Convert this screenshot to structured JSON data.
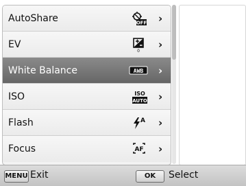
{
  "menu": {
    "items": [
      {
        "label": "AutoShare",
        "icon": "autoshare-off-icon"
      },
      {
        "label": "EV",
        "icon": "ev-icon",
        "sub": "0"
      },
      {
        "label": "White Balance",
        "icon": "awb-icon",
        "badge": "AWB",
        "selected": true
      },
      {
        "label": "ISO",
        "icon": "iso-auto-icon",
        "top": "ISO",
        "bottom": "AUTO"
      },
      {
        "label": "Flash",
        "icon": "flash-auto-icon",
        "sub": "A"
      },
      {
        "label": "Focus",
        "icon": "af-icon",
        "badge": "AF"
      }
    ]
  },
  "autoshare_icon": {
    "off_label": "OFF"
  },
  "footer": {
    "menu_key": "MENU",
    "exit_label": "Exit",
    "ok_key": "OK",
    "select_label": "Select"
  }
}
